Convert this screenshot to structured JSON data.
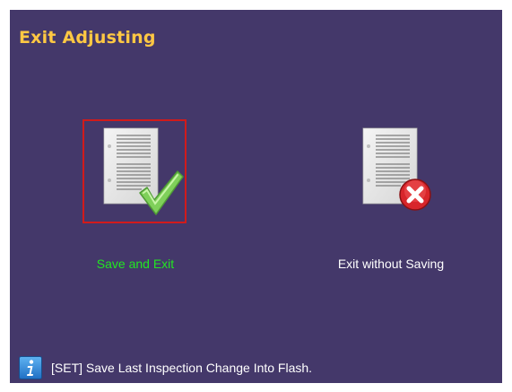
{
  "dialog": {
    "title": "Exit Adjusting"
  },
  "options": [
    {
      "label": "Save and Exit",
      "icon": "document-check-icon",
      "selected": true,
      "label_color": "#22e622"
    },
    {
      "label": "Exit without Saving",
      "icon": "document-cancel-icon",
      "selected": false,
      "label_color": "#ffffff"
    }
  ],
  "status_bar": {
    "icon": "info-icon",
    "text": "[SET] Save Last Inspection Change Into Flash."
  },
  "colors": {
    "panel_background": "#44386a",
    "title": "#ffc843",
    "selection_border": "#d11b1b",
    "info_icon": "#2a86d6"
  }
}
